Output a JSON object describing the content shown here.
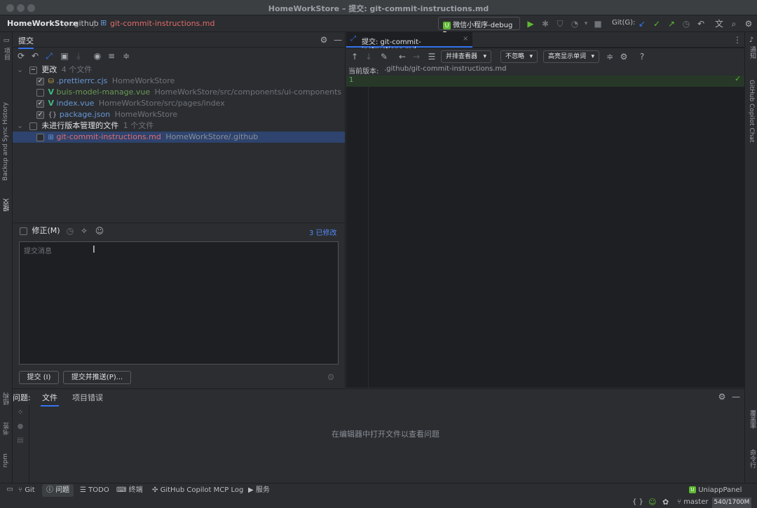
{
  "window": {
    "title": "HomeWorkStore – 提交: git-commit-instructions.md"
  },
  "navbar": {
    "crumbs": [
      "HomeWorkStore",
      ".github",
      "git-commit-instructions.md"
    ],
    "run_config": "微信小程序-debug",
    "git_label": "Git(G):"
  },
  "left_strip": {
    "items": [
      "项目",
      "Backup and Sync History",
      "提交",
      "结构",
      "书签",
      "npm"
    ]
  },
  "right_strip": {
    "items": [
      "通知",
      "GitHub Copilot Chat",
      "覆盖率",
      "命令行"
    ]
  },
  "commit_panel": {
    "title": "提交",
    "groups": [
      {
        "label": "更改",
        "count": "4 个文件",
        "files": [
          {
            "name": ".prettierrc.cjs",
            "path": "HomeWorkStore",
            "checked": true,
            "color": "#6897d6",
            "icon": "js-file-icon"
          },
          {
            "name": "buis-model-manage.vue",
            "path": "HomeWorkStore/src/components/ui-components",
            "checked": false,
            "color": "#6a9955",
            "icon": "vue-file-icon"
          },
          {
            "name": "index.vue",
            "path": "HomeWorkStore/src/pages/index",
            "checked": true,
            "color": "#6897d6",
            "icon": "vue-file-icon"
          },
          {
            "name": "package.json",
            "path": "HomeWorkStore",
            "checked": true,
            "color": "#6897d6",
            "icon": "json-file-icon"
          }
        ]
      },
      {
        "label": "未进行版本管理的文件",
        "count": "1 个文件",
        "files": [
          {
            "name": "git-commit-instructions.md",
            "path": "HomeWorkStore/.github",
            "checked": false,
            "color": "#e06c6c",
            "icon": "md-file-icon"
          }
        ]
      }
    ],
    "amend_label": "修正(M)",
    "modified_count": "3 已修改",
    "message_placeholder": "提交消息",
    "commit_button": "提交 (I)",
    "commit_push_button": "提交并推送(P)..."
  },
  "editor": {
    "tab_label": "提交: git-commit-instructions.md",
    "viewer_dropdown": "并排查看器",
    "ignore_dropdown": "不忽略",
    "highlight_dropdown": "高亮显示单词",
    "current_version_label": "当前版本:",
    "current_version_path": ".github/git-commit-instructions.md",
    "line_number": "1"
  },
  "problems": {
    "label": "问题:",
    "tabs": [
      "文件",
      "项目错误"
    ],
    "empty_text": "在编辑器中打开文件以查看问题"
  },
  "statusbar": {
    "left_tabs": [
      "Git",
      "问题",
      "TODO",
      "终端",
      "GitHub Copilot MCP Log",
      "服务"
    ],
    "uniapp_panel": "UniappPanel",
    "branch": "master",
    "memory": "540/1700M"
  },
  "colors": {
    "accent": "#3574f0",
    "green": "#5fb832",
    "selected_row": "#2e436e"
  }
}
